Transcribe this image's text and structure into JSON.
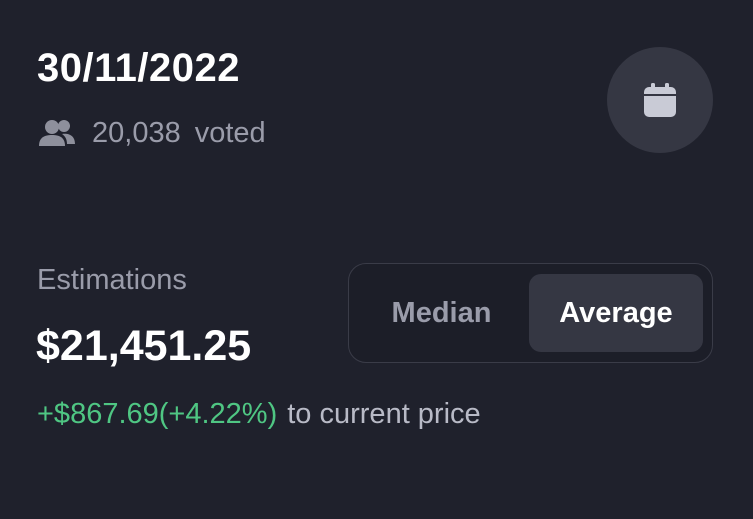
{
  "header": {
    "date": "30/11/2022",
    "votes_count": "20,038",
    "votes_label": "voted"
  },
  "calendar_button": {
    "icon": "calendar-icon"
  },
  "estimations": {
    "label": "Estimations",
    "value": "$21,451.25",
    "change": "+$867.69(+4.22%)",
    "change_suffix": "to current price"
  },
  "toggle": {
    "options": [
      "Median",
      "Average"
    ],
    "selected": "Average"
  },
  "colors": {
    "background": "#1f212c",
    "positive": "#4fc683",
    "muted_text": "#9a9caa",
    "selected_bg": "#353743"
  }
}
